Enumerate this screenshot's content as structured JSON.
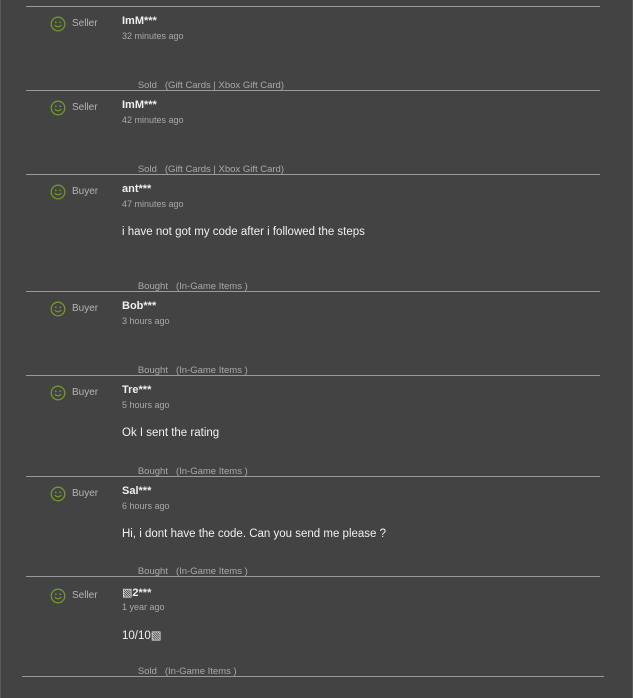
{
  "colors": {
    "background": "#434343",
    "separator": "#9a9a9a",
    "positive_icon": "#6f9a2c"
  },
  "reviews": [
    {
      "icon": "smile-positive-icon",
      "role": "Seller",
      "user": "ImM***",
      "time": "32 minutes ago",
      "comment": "",
      "type": "Sold",
      "category": "(Gift Cards | Xbox Gift Card)"
    },
    {
      "icon": "smile-positive-icon",
      "role": "Seller",
      "user": "ImM***",
      "time": "42 minutes ago",
      "comment": "",
      "type": "Sold",
      "category": "(Gift Cards | Xbox Gift Card)"
    },
    {
      "icon": "smile-positive-icon",
      "role": "Buyer",
      "user": "ant***",
      "time": "47 minutes ago",
      "comment": "i have not got my code after i followed the steps",
      "type": "Bought",
      "category": "(In-Game Items )"
    },
    {
      "icon": "smile-positive-icon",
      "role": "Buyer",
      "user": "Bob***",
      "time": "3 hours ago",
      "comment": "",
      "type": "Bought",
      "category": "(In-Game Items )"
    },
    {
      "icon": "smile-positive-icon",
      "role": "Buyer",
      "user": "Tre***",
      "time": "5 hours ago",
      "comment": "Ok I sent the rating",
      "type": "Bought",
      "category": "(In-Game Items )"
    },
    {
      "icon": "smile-positive-icon",
      "role": "Buyer",
      "user": "Sal***",
      "time": "6 hours ago",
      "comment": "Hi, i dont have the code. Can you send me please ?",
      "type": "Bought",
      "category": "(In-Game Items )"
    },
    {
      "icon": "smile-positive-icon",
      "role": "Seller",
      "user": "▧2***",
      "time": "1 year ago",
      "comment": "10/10▧",
      "type": "Sold",
      "category": "(In-Game Items )"
    }
  ]
}
